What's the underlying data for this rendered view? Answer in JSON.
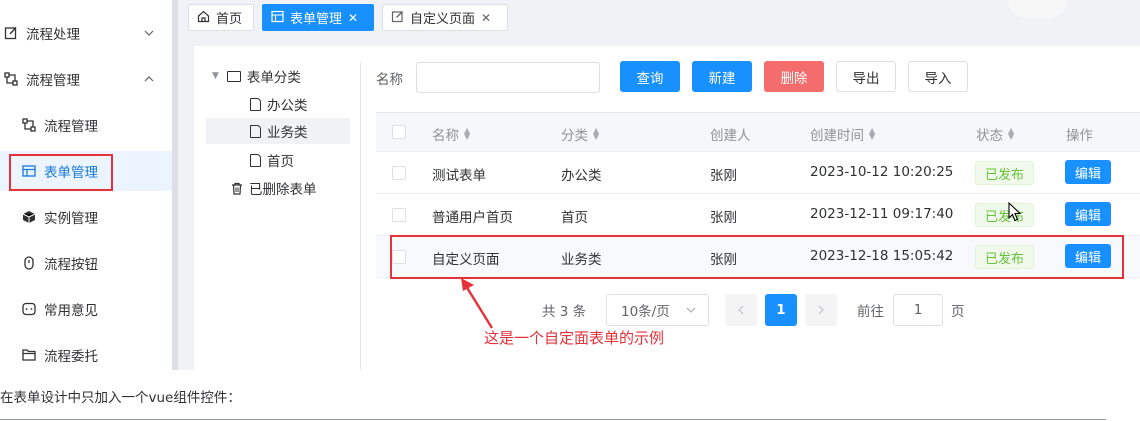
{
  "sidebar": {
    "items": [
      {
        "label": "流程处理",
        "icon": "edit-icon",
        "arrow": "chevron-down-icon"
      },
      {
        "label": "流程管理",
        "icon": "flow-icon",
        "arrow": "chevron-up-icon"
      },
      {
        "label": "流程管理",
        "icon": "flow-icon"
      },
      {
        "label": "表单管理",
        "icon": "form-icon",
        "active": true
      },
      {
        "label": "实例管理",
        "icon": "cube-icon"
      },
      {
        "label": "流程按钮",
        "icon": "button-icon"
      },
      {
        "label": "常用意见",
        "icon": "comment-icon"
      },
      {
        "label": "流程委托",
        "icon": "folder-icon"
      }
    ]
  },
  "tabs": [
    {
      "label": "首页",
      "icon": "home-icon"
    },
    {
      "label": "表单管理",
      "icon": "form-icon",
      "active": true,
      "close": "✕"
    },
    {
      "label": "自定义页面",
      "icon": "edit-icon",
      "close": "✕"
    }
  ],
  "tree": {
    "root": "表单分类",
    "children": [
      "办公类",
      "业务类",
      "首页"
    ],
    "selected": "业务类",
    "deleted": "已删除表单"
  },
  "search": {
    "name_label": "名称",
    "name_value": "",
    "buttons": {
      "query": "查询",
      "create": "新建",
      "delete": "删除",
      "export": "导出",
      "import": "导入"
    }
  },
  "table": {
    "columns": [
      "名称",
      "分类",
      "创建人",
      "创建时间",
      "状态",
      "操作"
    ],
    "rows": [
      {
        "name": "测试表单",
        "category": "办公类",
        "creator": "张刚",
        "created": "2023-10-12 10:20:25",
        "status": "已发布",
        "action": "编辑"
      },
      {
        "name": "普通用户首页",
        "category": "首页",
        "creator": "张刚",
        "created": "2023-12-11 09:17:40",
        "status": "已发布",
        "action": "编辑"
      },
      {
        "name": "自定义页面",
        "category": "业务类",
        "creator": "张刚",
        "created": "2023-12-18 15:05:42",
        "status": "已发布",
        "action": "编辑"
      }
    ]
  },
  "pagination": {
    "total": "共 3 条",
    "page_size": "10条/页",
    "current": "1",
    "goto_label": "前往",
    "goto_value": "1",
    "page_unit": "页"
  },
  "annotation": "这是一个自定面表单的示例",
  "caption": "在表单设计中只加入一个vue组件控件：",
  "colors": {
    "primary": "#1890ff",
    "danger": "#f56c6c",
    "highlight": "#e5323a",
    "success": "#67c23a"
  }
}
